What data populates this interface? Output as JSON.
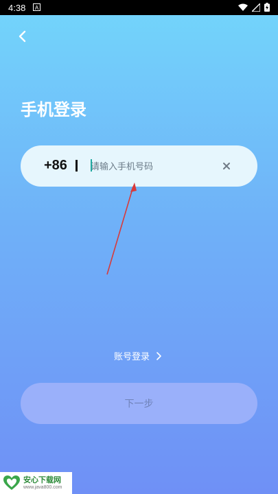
{
  "status_bar": {
    "time": "4:38",
    "notification_letter": "A"
  },
  "header": {
    "title": "手机登录"
  },
  "phone_field": {
    "country_code": "+86",
    "placeholder": "请输入手机号码",
    "value": ""
  },
  "links": {
    "account_login": "账号登录"
  },
  "buttons": {
    "next": "下一步"
  },
  "watermark": {
    "title": "安心下载网",
    "subtitle": "www.java800.com"
  },
  "colors": {
    "accent_teal": "#1fa8a0",
    "annotation_arrow": "#d83a3a"
  }
}
